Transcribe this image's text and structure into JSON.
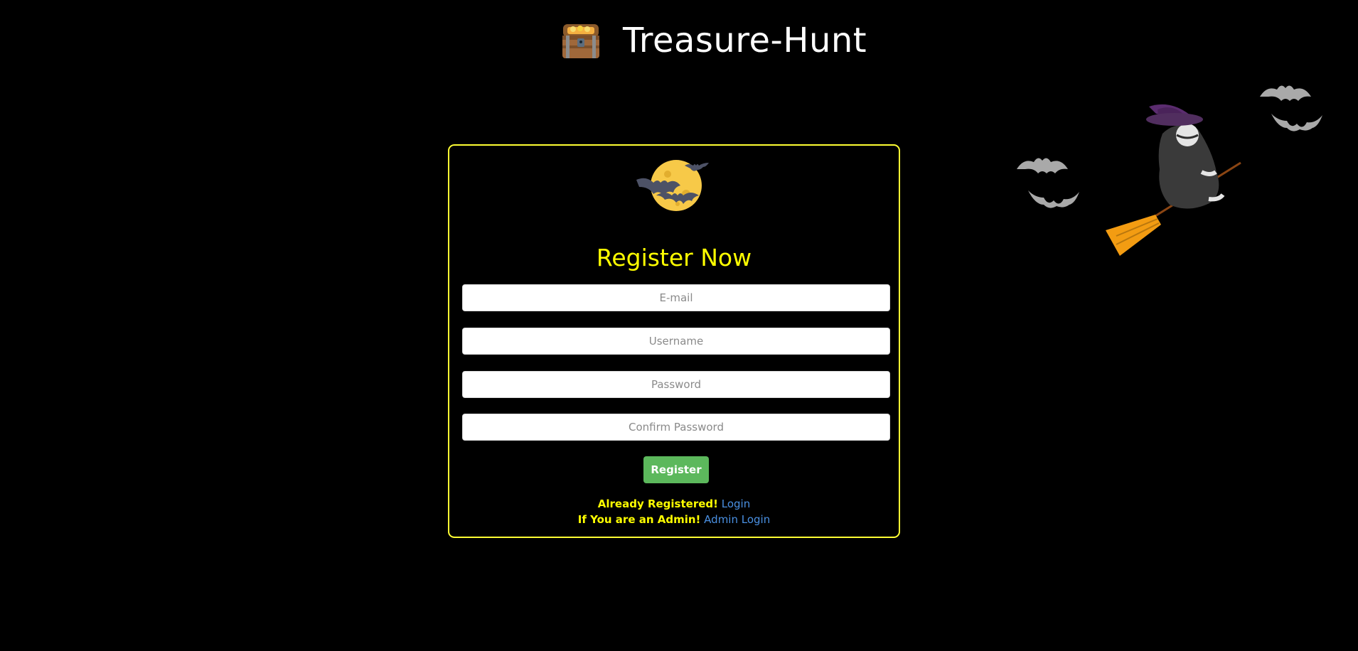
{
  "header": {
    "title": "Treasure-Hunt",
    "logo_icon": "treasure-chest-icon"
  },
  "decor": {
    "illustration": "witch-on-broom-with-bats"
  },
  "register_form": {
    "icon": "moon-with-bats-icon",
    "title": "Register Now",
    "email_placeholder": "E-mail",
    "username_placeholder": "Username",
    "password_placeholder": "Password",
    "confirm_password_placeholder": "Confirm Password",
    "register_label": "Register",
    "already_registered_text": "Already Registered!",
    "login_link": "Login",
    "admin_text": "If You are an Admin!",
    "admin_login_link": "Admin Login"
  },
  "colors": {
    "background": "#000000",
    "accent_yellow": "#ffff00",
    "card_border": "#ffff33",
    "button_green": "#5cb85c",
    "link_blue": "#4a90e2"
  }
}
